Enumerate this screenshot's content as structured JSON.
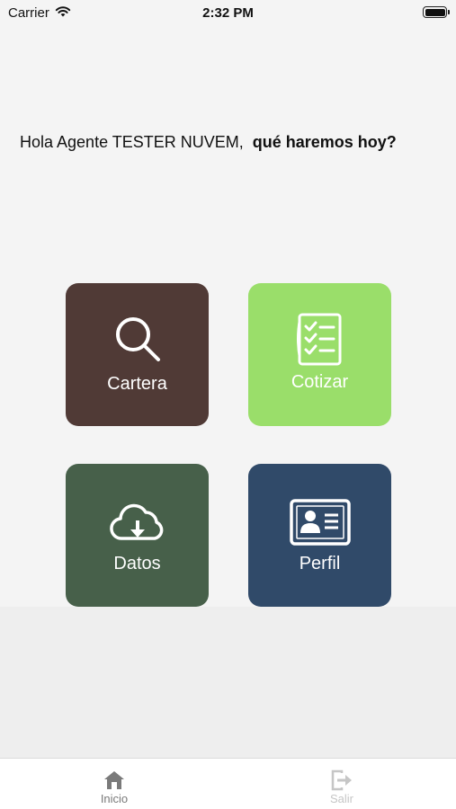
{
  "status_bar": {
    "carrier": "Carrier",
    "time": "2:32 PM"
  },
  "greeting": {
    "text": "Hola Agente TESTER NUVEM,",
    "question": "qué haremos hoy?"
  },
  "tiles": [
    {
      "label": "Cartera",
      "color": "#503a36",
      "icon": "search-icon"
    },
    {
      "label": "Cotizar",
      "color": "#9ade6a",
      "icon": "checklist-icon"
    },
    {
      "label": "Datos",
      "color": "#47604a",
      "icon": "cloud-download-icon"
    },
    {
      "label": "Perfil",
      "color": "#304a69",
      "icon": "id-card-icon"
    }
  ],
  "tabbar": {
    "items": [
      {
        "label": "Inicio",
        "icon": "home-icon",
        "color": "#7a7a7a"
      },
      {
        "label": "Salir",
        "icon": "logout-icon",
        "color": "#c6c6c6"
      }
    ]
  }
}
